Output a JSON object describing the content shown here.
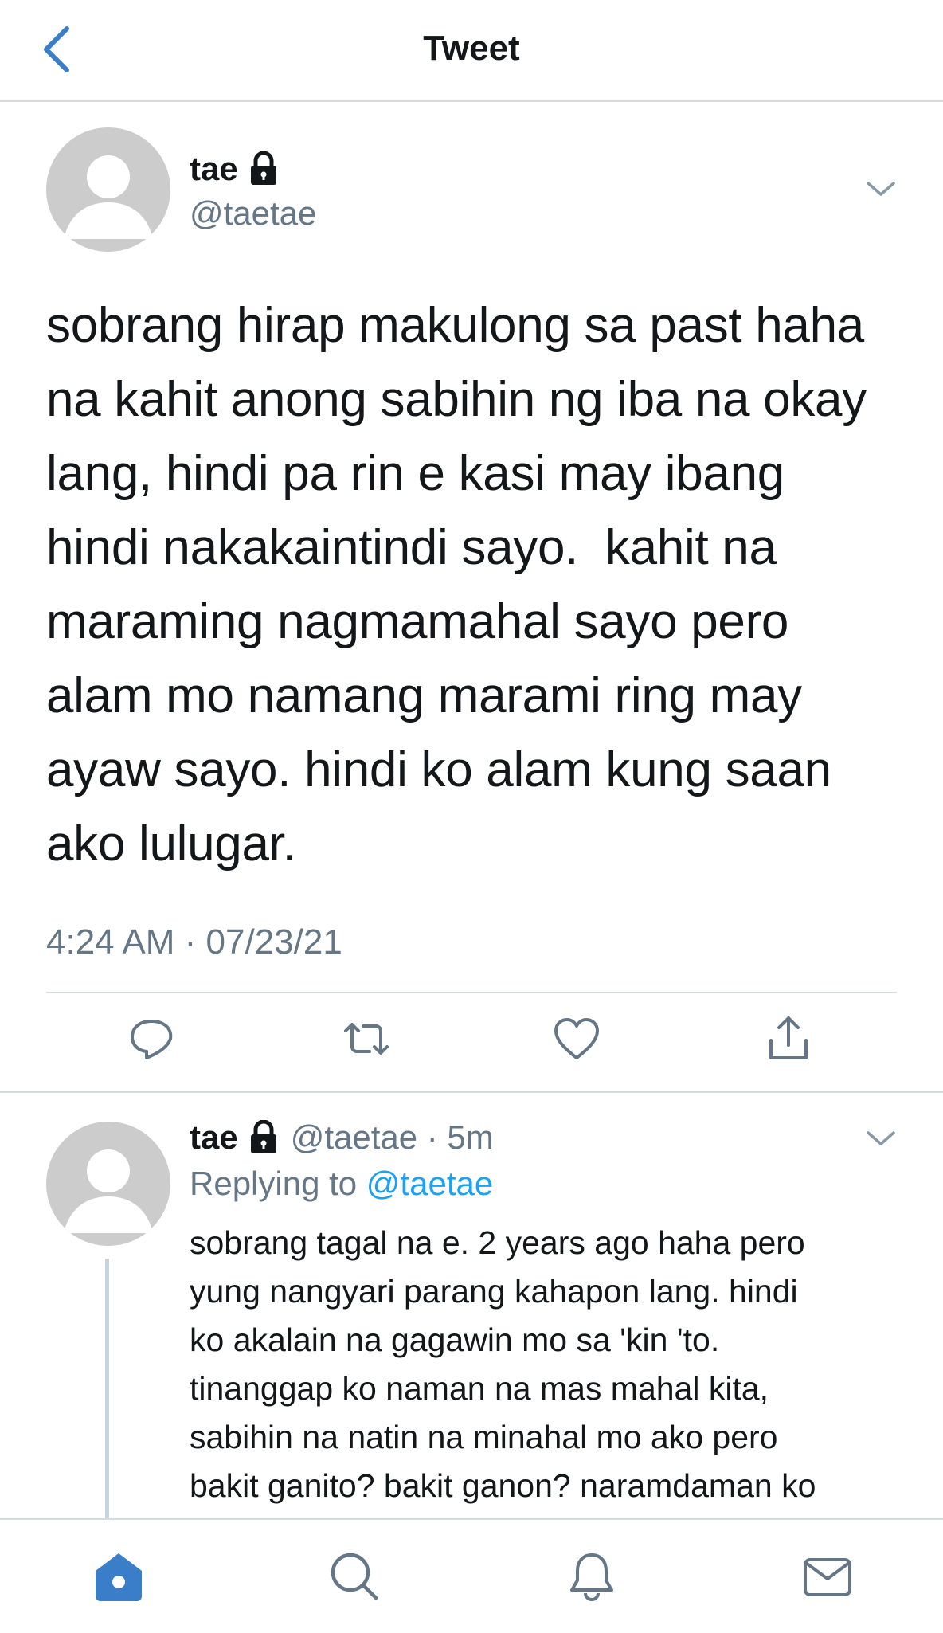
{
  "header": {
    "title": "Tweet"
  },
  "tweet": {
    "display_name": "tae",
    "handle": "@taetae",
    "text_lines": [
      "sobrang hirap makulong sa past haha",
      "na kahit anong sabihin ng iba na okay",
      "lang, hindi pa rin e kasi may ibang",
      "hindi nakakaintindi sayo.  kahit na",
      "maraming nagmamahal sayo pero",
      "alam mo namang marami ring may",
      "ayaw sayo. hindi ko alam kung saan",
      "ako lulugar."
    ],
    "timestamp": "4:24 AM · 07/23/21"
  },
  "reply": {
    "display_name": "tae",
    "handle_time": "@taetae · 5m",
    "replying_prefix": "Replying to ",
    "replying_handle": "@taetae",
    "text_lines": [
      "sobrang tagal na e. 2 years ago haha pero",
      "yung nangyari parang kahapon lang. hindi",
      "ko akalain na gagawin mo sa 'kin 'to.",
      "tinanggap ko naman na mas mahal kita,",
      "sabihin na natin na minahal mo ako pero",
      "bakit ganito? bakit ganon? naramdaman ko"
    ]
  },
  "colors": {
    "accent": "#1da1f2",
    "icon_gray": "#657786",
    "divider": "#d6dbe0",
    "avatar_bg": "#cccccc",
    "home_active": "#3a7dc9"
  },
  "icons": [
    "back-chevron-icon",
    "lock-icon",
    "chevron-down-icon",
    "reply-icon",
    "retweet-icon",
    "like-icon",
    "share-icon",
    "home-icon",
    "search-icon",
    "notifications-icon",
    "messages-icon"
  ]
}
